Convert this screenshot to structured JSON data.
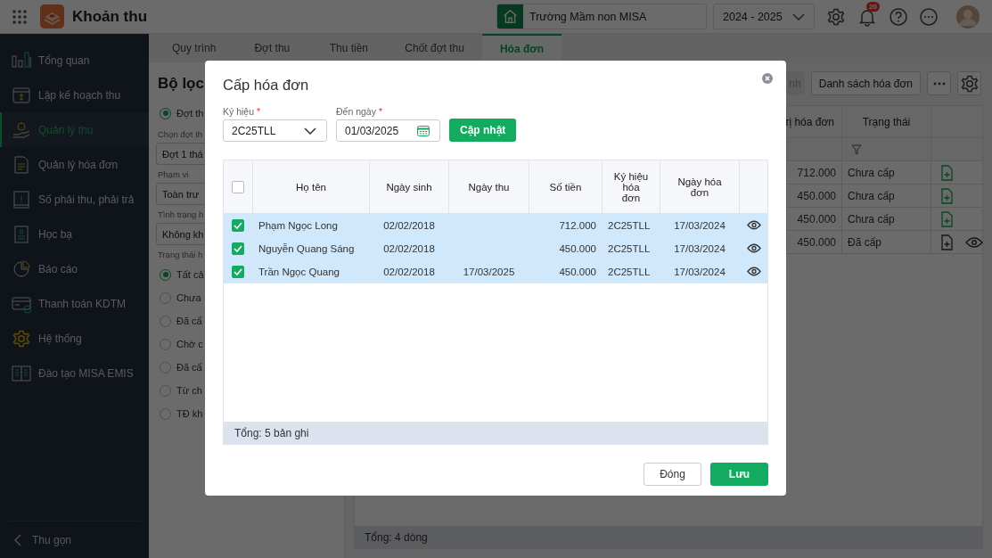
{
  "header": {
    "app_title": "Khoản thu",
    "school": "Trường Mầm non MISA",
    "school_year": "2024 - 2025",
    "notification_count": "20"
  },
  "sidebar": {
    "items": [
      {
        "label": "Tổng quan",
        "selected": false
      },
      {
        "label": "Lập kế hoạch thu",
        "selected": false
      },
      {
        "label": "Quản lý thu",
        "selected": true
      },
      {
        "label": "Quản lý hóa đơn",
        "selected": false
      },
      {
        "label": "Số phải thu, phải trả",
        "selected": false
      },
      {
        "label": "Học bạ",
        "selected": false
      },
      {
        "label": "Báo cáo",
        "selected": false
      },
      {
        "label": "Thanh toán KDTM",
        "selected": false
      },
      {
        "label": "Hệ thống",
        "selected": false
      },
      {
        "label": "Đào tạo MISA EMIS",
        "selected": false
      }
    ],
    "collapse": "Thu gọn"
  },
  "tabs": [
    {
      "label": "Quy trình",
      "selected": false
    },
    {
      "label": "Đợt thu",
      "selected": false
    },
    {
      "label": "Thu tiền",
      "selected": false
    },
    {
      "label": "Chốt đợt thu",
      "selected": false
    },
    {
      "label": "Hóa đơn",
      "selected": true
    }
  ],
  "filter": {
    "title": "Bộ lọc",
    "period_option": {
      "label": "Đợt th",
      "selected": true
    },
    "fields": [
      {
        "label": "Chọn đợt th",
        "value": "Đợt 1 thá"
      },
      {
        "label": "Phạm vi",
        "value": "Toàn trư"
      },
      {
        "label": "Tình trạng h",
        "value": "Không kh"
      }
    ],
    "status_label": "Trạng thái h",
    "status_options": [
      {
        "label": "Tất cả",
        "selected": true
      },
      {
        "label": "Chưa",
        "selected": false
      },
      {
        "label": "Đã cấ",
        "selected": false
      },
      {
        "label": "Chờ c",
        "selected": false
      },
      {
        "label": "Đã cấ",
        "selected": false
      },
      {
        "label": "Từ ch",
        "selected": false
      },
      {
        "label": "TĐ kh",
        "selected": false
      }
    ]
  },
  "toolbar": {
    "buttons": [
      {
        "label": "nh",
        "disabled": true
      },
      {
        "label": "Danh sách hóa đơn",
        "disabled": false
      }
    ]
  },
  "main_table": {
    "columns": [
      "rị hóa đơn",
      "Trạng thái"
    ],
    "rows": [
      {
        "amount": "712.000",
        "status": "Chưa cấp",
        "issued": false
      },
      {
        "amount": "450.000",
        "status": "Chưa cấp",
        "issued": false
      },
      {
        "amount": "450.000",
        "status": "Chưa cấp",
        "issued": false
      },
      {
        "amount": "450.000",
        "status": "Đã cấp",
        "issued": true
      }
    ],
    "footer": "Tổng: 4 dòng"
  },
  "dialog": {
    "title": "Cấp hóa đơn",
    "fields": [
      {
        "kind": "select",
        "label": "Ký hiệu",
        "required_mark": "*",
        "value": "2C25TLL"
      },
      {
        "kind": "date",
        "label": "Đến ngày",
        "required_mark": "*",
        "value": "01/03/2025"
      }
    ],
    "update_button": "Cập nhật",
    "table": {
      "all_checked": false,
      "columns": [
        "Họ tên",
        "Ngày sinh",
        "Ngày thu",
        "Số tiền",
        "Ký hiệu hóa đơn",
        "Ngày hóa đơn"
      ],
      "rows": [
        {
          "checked": true,
          "name": "Phạm Ngọc Long",
          "birth_date": "02/02/2018",
          "paid_date": "",
          "amount": "712.000",
          "symbol": "2C25TLL",
          "invoice_date": "17/03/2024"
        },
        {
          "checked": true,
          "name": "Nguyễn Quang Sáng",
          "birth_date": "02/02/2018",
          "paid_date": "",
          "amount": "450.000",
          "symbol": "2C25TLL",
          "invoice_date": "17/03/2024"
        },
        {
          "checked": true,
          "name": "Trần Ngọc Quang",
          "birth_date": "02/02/2018",
          "paid_date": "17/03/2025",
          "amount": "450.000",
          "symbol": "2C25TLL",
          "invoice_date": "17/03/2024"
        }
      ],
      "footer": "Tổng: 5 bản ghi"
    },
    "close_button": "Đóng",
    "save_button": "Lưu"
  }
}
